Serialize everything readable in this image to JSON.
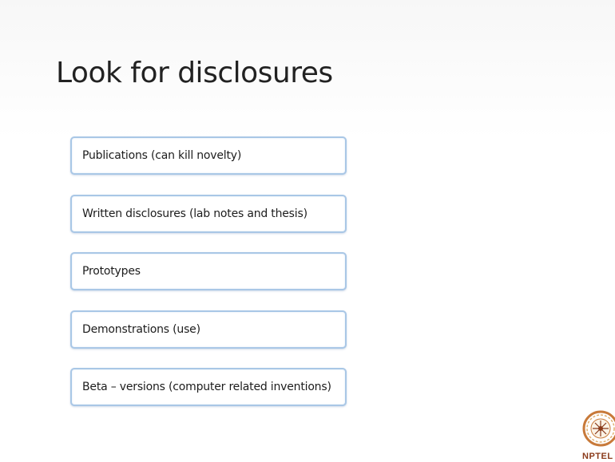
{
  "slide": {
    "title": "Look for disclosures",
    "items": [
      {
        "label": "Publications (can kill novelty)"
      },
      {
        "label": "Written disclosures (lab notes and thesis)"
      },
      {
        "label": "Prototypes"
      },
      {
        "label": "Demonstrations (use)"
      },
      {
        "label": "Beta – versions (computer related inventions)"
      }
    ]
  },
  "logo": {
    "icon": "nptel-logo-icon",
    "text": "NPTEL"
  },
  "colors": {
    "box_border": "#a9c7e6",
    "title_text": "#222222",
    "logo_brown": "#8a3a1a"
  }
}
